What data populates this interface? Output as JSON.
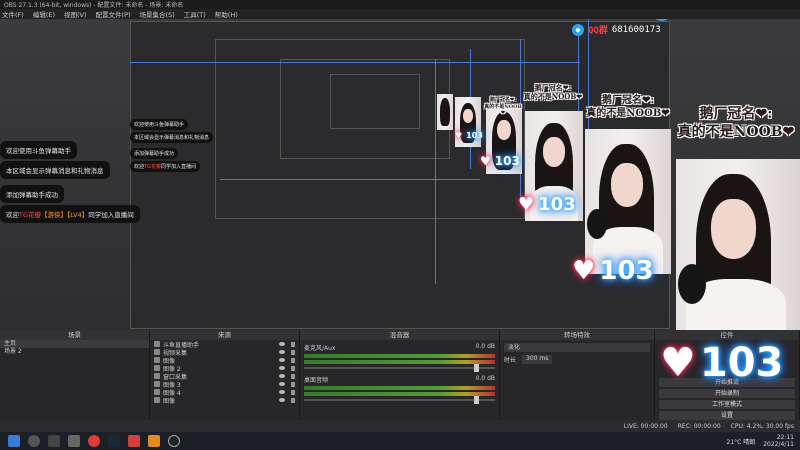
{
  "window": {
    "title": "OBS 27.1.3 (64-bit, windows) - 配置文件: 未命名 - 场景: 未命名"
  },
  "menu": [
    "文件(F)",
    "编辑(E)",
    "视图(V)",
    "配置文件(P)",
    "场景集合(S)",
    "工具(T)",
    "帮助(H)"
  ],
  "qq": {
    "label": "QQ群",
    "number": "681600173"
  },
  "chat_messages": [
    {
      "text": "欢迎使用斗鱼弹幕助手"
    },
    {
      "text": "本区域会显示弹幕消息和礼物消息"
    },
    {
      "text": "添加弹幕助手成功"
    },
    {
      "prefix": "欢迎",
      "user": "TG花瓣",
      "tag1": "【游侠】",
      "tag2": "【LV4】",
      "suffix": "同学加入直播间"
    }
  ],
  "caption": {
    "line1": "鹅厂冠名❤:",
    "line2": "真的不是NOOB❤"
  },
  "neon": {
    "heart": "♥",
    "count": "103"
  },
  "docks": {
    "scenes": {
      "title": "场景",
      "items": [
        "主页",
        "场景 2"
      ]
    },
    "sources": {
      "title": "来源",
      "items": [
        "斗鱼直播助手",
        "视频采集",
        "图像",
        "图像 2",
        "窗口采集",
        "图像 3",
        "图像 4",
        "图像"
      ]
    },
    "mixer": {
      "title": "混音器",
      "channels": [
        {
          "name": "麦克风/Aux",
          "db": "0.0 dB"
        },
        {
          "name": "桌面音频",
          "db": "0.0 dB"
        }
      ]
    },
    "transitions": {
      "title": "转场特效",
      "type": "淡化",
      "duration_label": "时长",
      "duration": "300 ms"
    },
    "controls": {
      "title": "控件",
      "buttons": [
        "开始推流",
        "开始录制",
        "工作室模式",
        "设置",
        "退出"
      ]
    }
  },
  "status": {
    "live": "LIVE: 00:00:00",
    "rec": "REC: 00:00:00",
    "cpu": "CPU: 4.2%, 30.00 fps"
  },
  "taskbar": {
    "weather": "21°C 晴朗",
    "time": "22:11",
    "date": "2022/4/11"
  },
  "colors": {
    "accent": "#4a7ad8",
    "neon_blue": "#2aa8ff",
    "neon_pink": "#ff2a5a"
  }
}
